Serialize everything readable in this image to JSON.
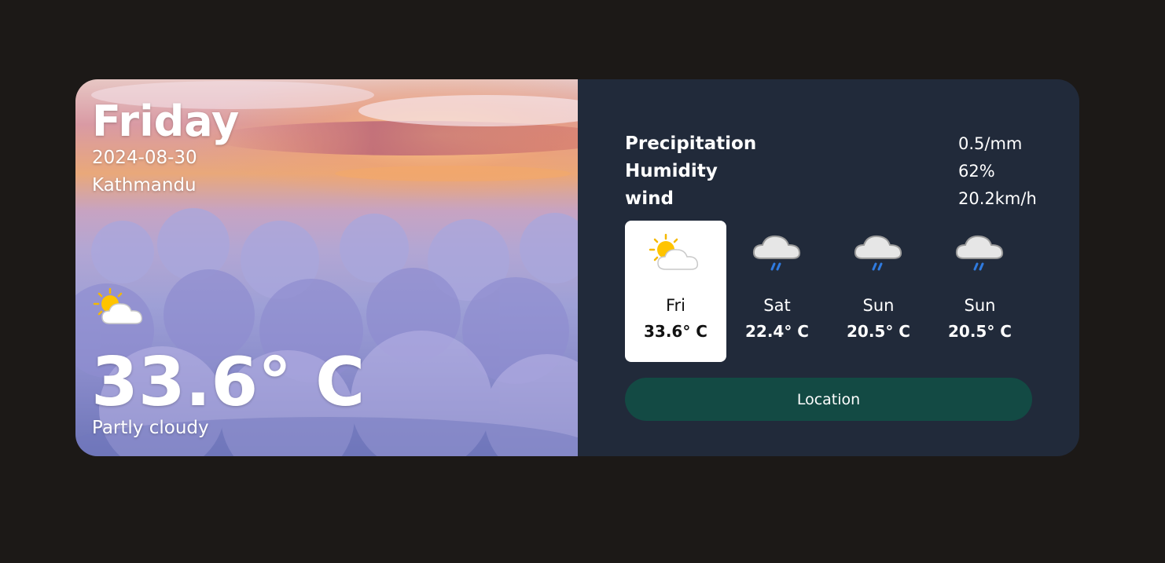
{
  "current": {
    "day": "Friday",
    "date": "2024-08-30",
    "location": "Kathmandu",
    "temperature": "33.6° C",
    "condition": "Partly cloudy",
    "icon": "partly-cloudy-icon"
  },
  "stats": [
    {
      "label": "Precipitation",
      "value": "0.5/mm"
    },
    {
      "label": "Humidity",
      "value": "62%"
    },
    {
      "label": "wind",
      "value": "20.2km/h"
    }
  ],
  "forecast": [
    {
      "day": "Fri",
      "temp": "33.6° C",
      "icon": "partly-cloudy-icon",
      "selected": true
    },
    {
      "day": "Sat",
      "temp": "22.4° C",
      "icon": "rain-cloud-icon",
      "selected": false
    },
    {
      "day": "Sun",
      "temp": "20.5° C",
      "icon": "rain-cloud-icon",
      "selected": false
    },
    {
      "day": "Sun",
      "temp": "20.5° C",
      "icon": "rain-cloud-icon",
      "selected": false
    }
  ],
  "location_button": "Location",
  "colors": {
    "page_bg": "#1c1917",
    "panel_bg": "#212a3a",
    "button_bg": "#134a44",
    "selected_card_bg": "#ffffff"
  }
}
